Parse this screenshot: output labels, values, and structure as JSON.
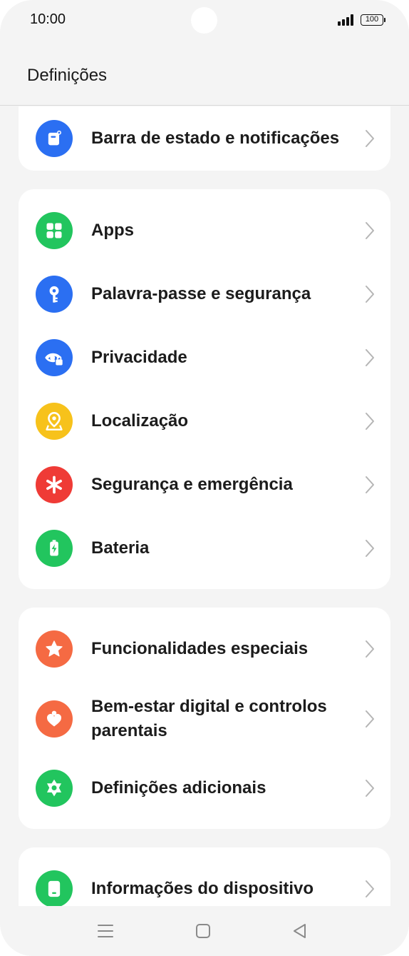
{
  "status_bar": {
    "time": "10:00",
    "battery": "100"
  },
  "header": {
    "title": "Definições"
  },
  "colors": {
    "blue": "#2b6ff2",
    "green": "#22c55e",
    "yellow": "#f7c21b",
    "red": "#ef3b36",
    "orange": "#f56a43",
    "card_bg": "#ffffff",
    "page_bg": "#f4f4f4"
  },
  "groups": [
    {
      "items": [
        {
          "label": "Barra de estado e notificações",
          "icon": "notification-bar-icon",
          "color": "#2b6ff2"
        }
      ]
    },
    {
      "items": [
        {
          "label": "Apps",
          "icon": "apps-grid-icon",
          "color": "#22c55e"
        },
        {
          "label": "Palavra-passe e segurança",
          "icon": "key-icon",
          "color": "#2b6ff2"
        },
        {
          "label": "Privacidade",
          "icon": "eye-lock-icon",
          "color": "#2b6ff2"
        },
        {
          "label": "Localização",
          "icon": "location-pin-icon",
          "color": "#f7c21b"
        },
        {
          "label": "Segurança e emergência",
          "icon": "asterisk-icon",
          "color": "#ef3b36"
        },
        {
          "label": "Bateria",
          "icon": "battery-icon",
          "color": "#22c55e"
        }
      ]
    },
    {
      "items": [
        {
          "label": "Funcionalidades especiais",
          "icon": "star-icon",
          "color": "#f56a43"
        },
        {
          "label": "Bem-estar digital e controlos parentais",
          "icon": "heart-person-icon",
          "color": "#f56a43"
        },
        {
          "label": "Definições adicionais",
          "icon": "gear-icon",
          "color": "#22c55e"
        }
      ]
    },
    {
      "items": [
        {
          "label": "Informações do dispositivo",
          "icon": "device-info-icon",
          "color": "#22c55e"
        }
      ]
    }
  ],
  "navbar": {
    "menu": "menu-icon",
    "home": "home-icon",
    "back": "back-icon"
  }
}
